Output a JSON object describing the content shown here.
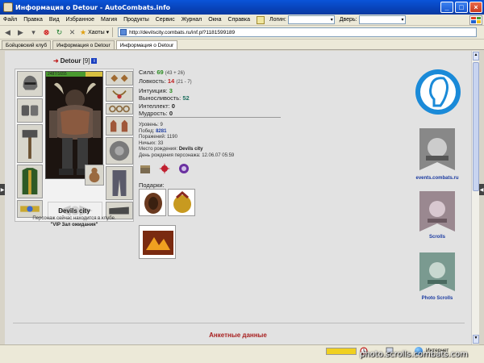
{
  "window": {
    "title": "Информация о Detour - AutoCombats.info"
  },
  "menu": {
    "items": [
      "Файл",
      "Правка",
      "Вид",
      "Избранное",
      "Магия",
      "Продукты",
      "Сервис",
      "Журнал",
      "Окна",
      "Справка"
    ],
    "login_label": "Логин:",
    "door_label": "Дверь:"
  },
  "toolbar": {
    "favorites_label": "Хаоты",
    "url": "http://devilscity.combats.ru/inf.pl?1181599189"
  },
  "tabs": [
    "Бойцовский клуб",
    "Информация о Detour",
    "Информация о Detour"
  ],
  "character": {
    "name": "Detour",
    "level": "[9]",
    "hp_text": "2487/1655",
    "hp_ratio": 0.7,
    "city": "Devils city",
    "location_line1": "Персонаж сейчас находится в клубе.",
    "location_line2": "\"VIP Зал ожидания\""
  },
  "stats": [
    {
      "label": "Сила:",
      "value": "69",
      "extra": "(43 + 26)",
      "color": "green"
    },
    {
      "label": "Ловкость:",
      "value": "14",
      "extra": "(21 - 7)",
      "color": "red"
    },
    {
      "label": "Интуиция:",
      "value": "3",
      "extra": "",
      "color": "green"
    },
    {
      "label": "Выносливость:",
      "value": "52",
      "extra": "",
      "color": "teal"
    },
    {
      "label": "Интеллект:",
      "value": "0",
      "extra": "",
      "color": ""
    },
    {
      "label": "Мудрость:",
      "value": "0",
      "extra": "",
      "color": ""
    }
  ],
  "info": {
    "level_label": "Уровень:",
    "level_value": "9",
    "wins_label": "Побед:",
    "wins_value": "8281",
    "losses_label": "Поражений:",
    "losses_value": "1190",
    "draws_label": "Ничьих:",
    "draws_value": "33",
    "birthplace_label": "Место рождения:",
    "birthplace_value": "Devils city",
    "birthday_label": "День рождения персонажа:",
    "birthday_value": "12.06.07 05:59"
  },
  "gifts_title": "Подарки:",
  "banners": {
    "events": "events.combats.ru",
    "scrolls": "Scrolls",
    "photo": "Photo Scrolls"
  },
  "anketa_title": "Анкетные данные",
  "statusbar": {
    "internet": "Интернет"
  },
  "watermark": "photo.scrolls.combats.com",
  "colors": {
    "titlebar": "#0a54d8",
    "content_bg": "#e2e2e2",
    "link": "#1a3aa0",
    "accent_red": "#a82020"
  }
}
